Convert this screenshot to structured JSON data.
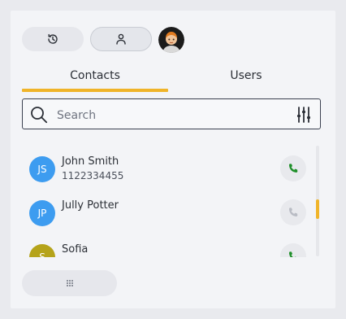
{
  "toolbar": {
    "history_icon": "history-icon",
    "user_icon": "user-icon",
    "avatar": "profile-avatar"
  },
  "tabs": [
    {
      "label": "Contacts",
      "active": true
    },
    {
      "label": "Users",
      "active": false
    }
  ],
  "search": {
    "placeholder": "Search",
    "value": ""
  },
  "contacts": [
    {
      "initials": "JS",
      "name": "John Smith",
      "phone": "1122334455",
      "avatar_color": "#3d9cf0",
      "call_enabled": true
    },
    {
      "initials": "JP",
      "name": "Jully Potter",
      "phone": "",
      "avatar_color": "#3d9cf0",
      "call_enabled": false
    },
    {
      "initials": "S",
      "name": "Sofia",
      "phone": "",
      "avatar_color": "#b5a31a",
      "call_enabled": true
    }
  ],
  "colors": {
    "accent": "#f0b429",
    "call_active": "#1f8f2a",
    "call_disabled": "#b9bcc4"
  },
  "bottom_bar": {
    "handle_icon": "grip-dots-icon"
  }
}
